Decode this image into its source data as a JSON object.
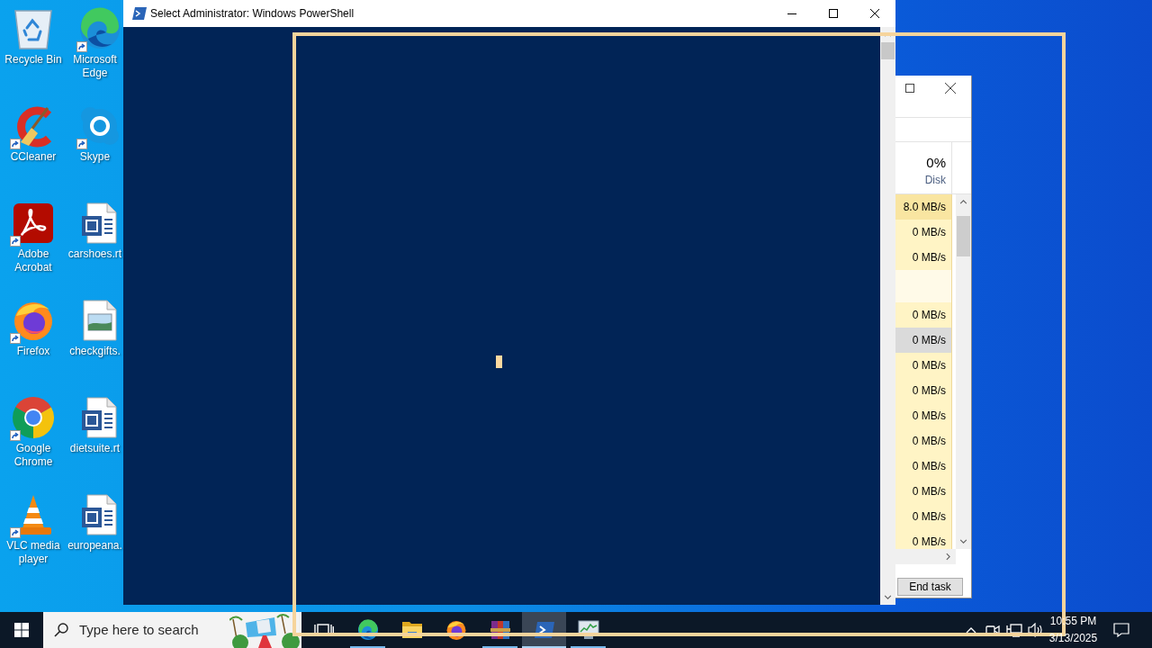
{
  "desktop": {
    "icons": [
      {
        "label": "Recycle Bin",
        "kind": "recycle-bin",
        "shortcut": false
      },
      {
        "label": "Microsoft Edge",
        "kind": "edge",
        "shortcut": true
      },
      {
        "label": "CCleaner",
        "kind": "ccleaner",
        "shortcut": true
      },
      {
        "label": "Skype",
        "kind": "skype",
        "shortcut": true
      },
      {
        "label": "Adobe Acrobat",
        "kind": "acrobat",
        "shortcut": true
      },
      {
        "label": "carshoes.rt",
        "kind": "word-document",
        "shortcut": false
      },
      {
        "label": "Firefox",
        "kind": "firefox",
        "shortcut": true
      },
      {
        "label": "checkgifts.",
        "kind": "image-file",
        "shortcut": false
      },
      {
        "label": "Google Chrome",
        "kind": "chrome",
        "shortcut": true
      },
      {
        "label": "dietsuite.rt",
        "kind": "word-document",
        "shortcut": false
      },
      {
        "label": "VLC media player",
        "kind": "vlc",
        "shortcut": true
      },
      {
        "label": "europeana.",
        "kind": "word-document",
        "shortcut": false
      }
    ]
  },
  "powershell_window": {
    "title": "Select Administrator: Windows PowerShell"
  },
  "task_manager": {
    "header": {
      "value": "0%",
      "label": "Disk"
    },
    "rows": [
      {
        "kind": "process",
        "value": "8.0 MB/s",
        "hot": true,
        "selected": false
      },
      {
        "kind": "process",
        "value": "0 MB/s",
        "hot": false,
        "selected": false
      },
      {
        "kind": "process",
        "value": "0 MB/s",
        "hot": false,
        "selected": false
      },
      {
        "kind": "group",
        "selected": false
      },
      {
        "kind": "process",
        "value": "0 MB/s",
        "hot": false,
        "selected": false
      },
      {
        "kind": "process",
        "value": "0 MB/s",
        "selected": true
      },
      {
        "kind": "process",
        "value": "0 MB/s",
        "hot": false,
        "selected": false
      },
      {
        "kind": "process",
        "value": "0 MB/s",
        "hot": false,
        "selected": false
      },
      {
        "kind": "process",
        "value": "0 MB/s",
        "hot": false,
        "selected": false
      },
      {
        "kind": "process",
        "value": "0 MB/s",
        "hot": false,
        "selected": false
      },
      {
        "kind": "process",
        "value": "0 MB/s",
        "hot": false,
        "selected": false
      },
      {
        "kind": "process",
        "value": "0 MB/s",
        "hot": false,
        "selected": false
      },
      {
        "kind": "process",
        "value": "0 MB/s",
        "hot": false,
        "selected": false
      },
      {
        "kind": "process",
        "value": "0 MB/s",
        "hot": false,
        "selected": false
      }
    ],
    "button": "End task"
  },
  "taskbar": {
    "search": {
      "placeholder": "Type here to search"
    },
    "apps": [
      {
        "kind": "edge",
        "running": true,
        "selected": false
      },
      {
        "kind": "explorer",
        "running": false,
        "selected": false
      },
      {
        "kind": "firefox",
        "running": false,
        "selected": false
      },
      {
        "kind": "winrar",
        "running": true,
        "selected": false
      },
      {
        "kind": "powershell",
        "running": true,
        "selected": true
      },
      {
        "kind": "task-manager",
        "running": true,
        "selected": false
      }
    ],
    "clock": {
      "time": "10:55 PM",
      "date": "3/13/2025"
    }
  }
}
